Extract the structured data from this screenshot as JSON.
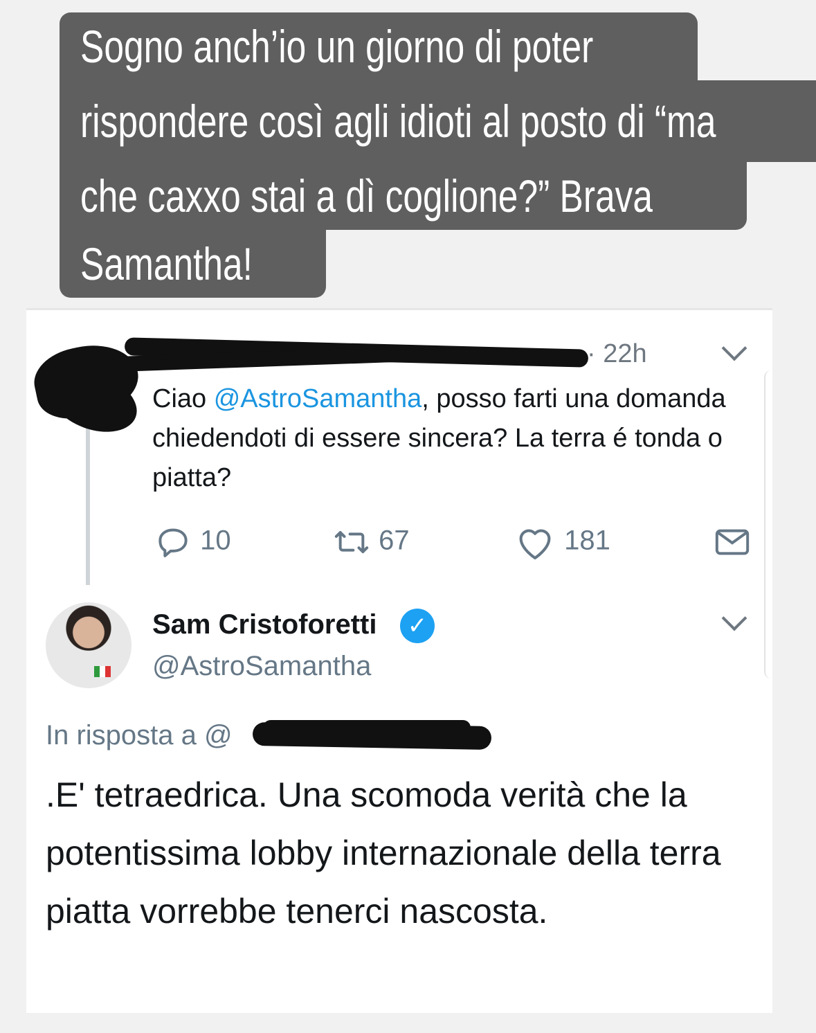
{
  "caption": {
    "lines": [
      "Sogno anch’io un giorno di poter",
      "rispondere così agli idioti al posto di “ma",
      "che caxxo stai a dì coglione?” Brava",
      "Samantha!"
    ]
  },
  "tweet1": {
    "time": "· 22h",
    "text_before": "Ciao ",
    "mention": "@AstroSamantha",
    "text_after": ", posso farti una domanda chiedendoti di essere sincera? La terra é tonda o piatta?",
    "replies": "10",
    "retweets": "67",
    "likes": "181"
  },
  "tweet2": {
    "name": "Sam Cristoforetti",
    "handle": "@AstroSamantha",
    "reply_prefix": "In risposta a @",
    "text": ".E' tetraedrica. Una scomoda verità che la potentissima lobby internazionale della terra piatta vorrebbe tenerci nascosta."
  },
  "colors": {
    "caption_bg": "#5f5f5f",
    "link": "#1b95e0",
    "verified": "#1da1f2",
    "muted": "#657786"
  },
  "icons": [
    "reply-icon",
    "retweet-icon",
    "like-icon",
    "message-icon",
    "chevron-down-icon",
    "verified-icon"
  ]
}
